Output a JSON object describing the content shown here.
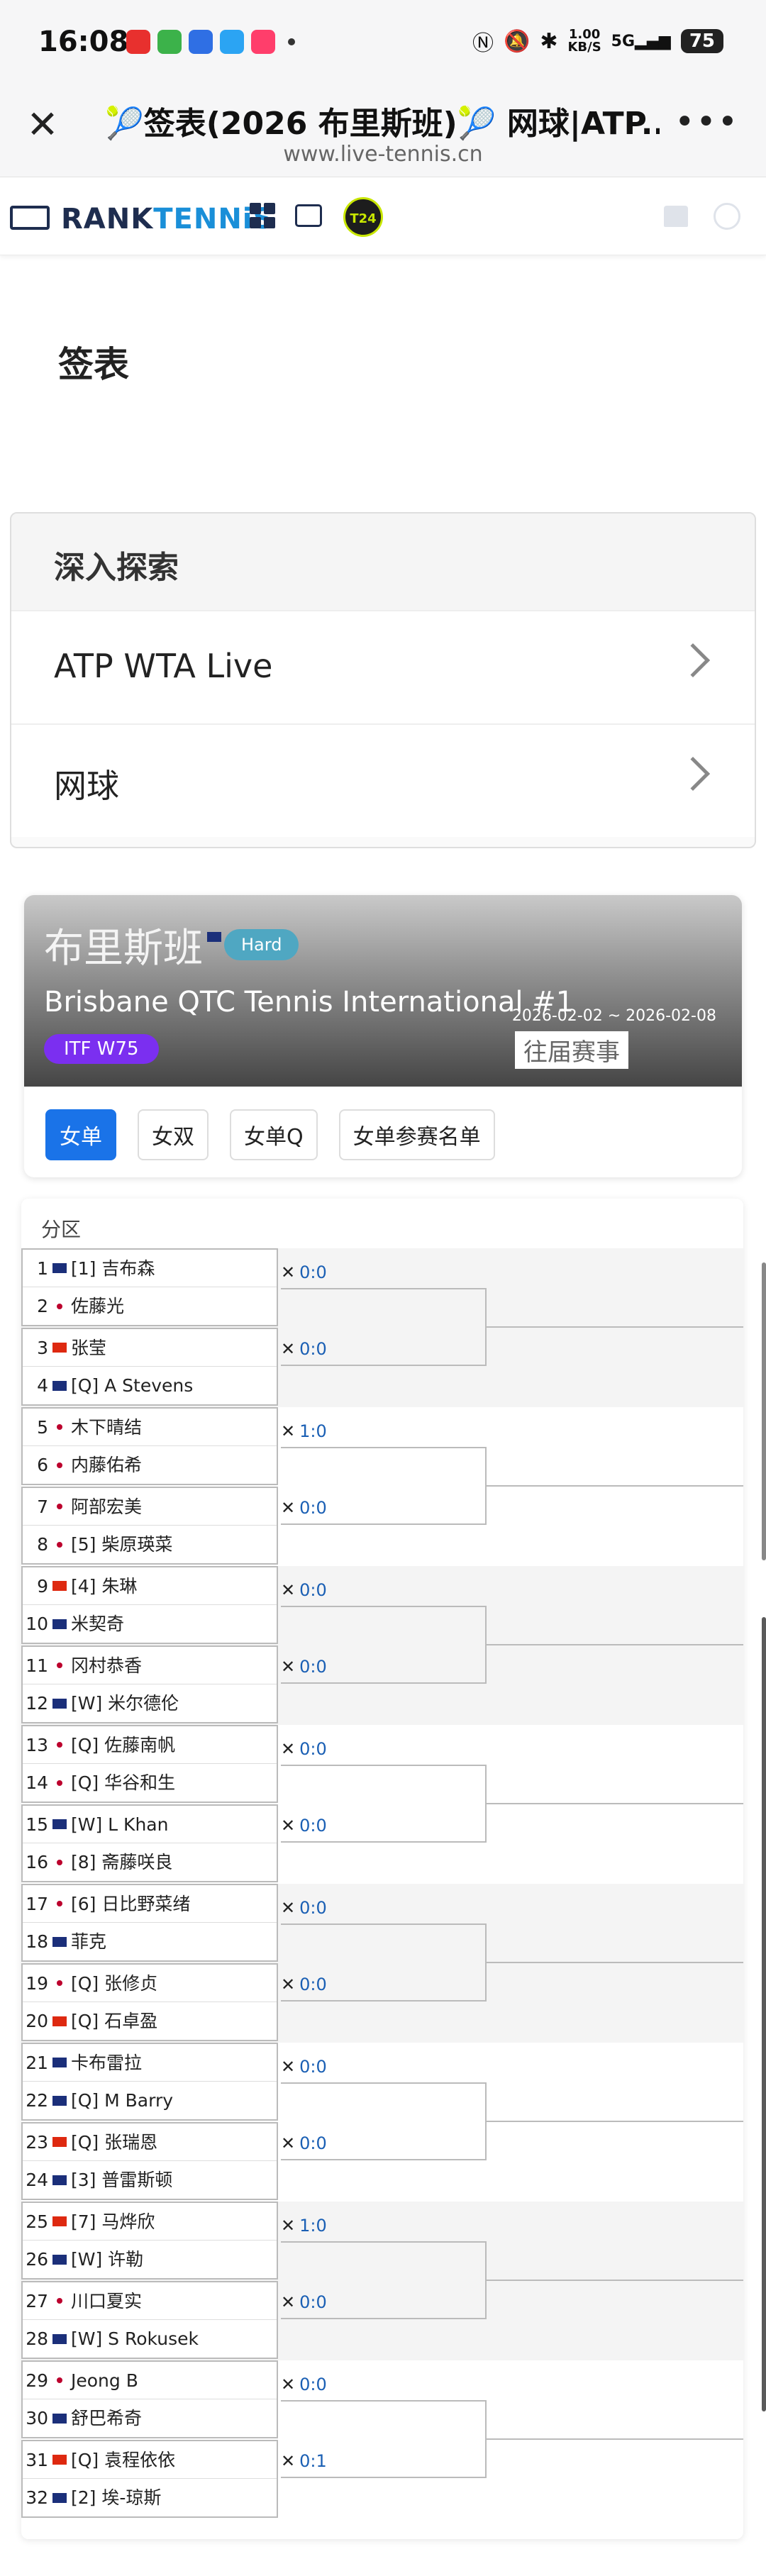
{
  "status_bar": {
    "time": "16:08",
    "speed_value": "1.00",
    "speed_unit": "KB/S",
    "network": "5G",
    "battery": "75"
  },
  "browser": {
    "title": "🎾签表(2026 布里斯班)🎾 网球|ATP...",
    "url": "www.live-tennis.cn",
    "close_icon": "close-icon",
    "more_icon": "more-dots-icon"
  },
  "site_nav": {
    "logo_text_a": "RANK",
    "logo_text_b": "TENNiS",
    "t24_label": "T24"
  },
  "section_title": "签表",
  "explore": {
    "heading": "深入探索",
    "items": [
      {
        "label": "ATP WTA Live"
      },
      {
        "label": "网球"
      }
    ]
  },
  "tournament": {
    "city": "布里斯班",
    "surface": "Hard",
    "name": "Brisbane QTC Tennis International #1",
    "dates": "2026-02-02 ~ 2026-02-08",
    "level": "ITF W75",
    "past_events": "往届赛事",
    "tabs": [
      "女单",
      "女双",
      "女单Q",
      "女单参赛名单"
    ]
  },
  "draw": {
    "heading": "分区",
    "colors": {
      "AUS": "#1b2f7a",
      "JPN": "#ffffff",
      "CHN": "#de2910",
      "KOR": "#ffffff",
      "HKG": "#de2910"
    },
    "matches": [
      {
        "p1": {
          "num": "1",
          "flag": "AUS",
          "name": "[1] 吉布森"
        },
        "p2": {
          "num": "2",
          "flag": "JPN",
          "name": "佐藤光"
        }
      },
      {
        "p1": {
          "num": "3",
          "flag": "CHN",
          "name": "张莹"
        },
        "p2": {
          "num": "4",
          "flag": "AUS",
          "name": "[Q] A Stevens"
        }
      },
      {
        "p1": {
          "num": "5",
          "flag": "JPN",
          "name": "木下晴结"
        },
        "p2": {
          "num": "6",
          "flag": "JPN",
          "name": "内藤佑希"
        }
      },
      {
        "p1": {
          "num": "7",
          "flag": "JPN",
          "name": "阿部宏美"
        },
        "p2": {
          "num": "8",
          "flag": "JPN",
          "name": "[5] 柴原瑛菜"
        }
      },
      {
        "p1": {
          "num": "9",
          "flag": "CHN",
          "name": "[4] 朱琳"
        },
        "p2": {
          "num": "10",
          "flag": "AUS",
          "name": "米契奇"
        }
      },
      {
        "p1": {
          "num": "11",
          "flag": "JPN",
          "name": "冈村恭香"
        },
        "p2": {
          "num": "12",
          "flag": "AUS",
          "name": "[W] 米尔德伦"
        }
      },
      {
        "p1": {
          "num": "13",
          "flag": "JPN",
          "name": "[Q] 佐藤南帆"
        },
        "p2": {
          "num": "14",
          "flag": "JPN",
          "name": "[Q] 华谷和生"
        }
      },
      {
        "p1": {
          "num": "15",
          "flag": "AUS",
          "name": "[W] L Khan"
        },
        "p2": {
          "num": "16",
          "flag": "JPN",
          "name": "[8] 斋藤咲良"
        }
      },
      {
        "p1": {
          "num": "17",
          "flag": "JPN",
          "name": "[6] 日比野菜绪"
        },
        "p2": {
          "num": "18",
          "flag": "AUS",
          "name": "菲克"
        }
      },
      {
        "p1": {
          "num": "19",
          "flag": "KOR",
          "name": "[Q] 张修贞"
        },
        "p2": {
          "num": "20",
          "flag": "HKG",
          "name": "[Q] 石卓盈"
        }
      },
      {
        "p1": {
          "num": "21",
          "flag": "AUS",
          "name": "卡布雷拉"
        },
        "p2": {
          "num": "22",
          "flag": "AUS",
          "name": "[Q] M Barry"
        }
      },
      {
        "p1": {
          "num": "23",
          "flag": "CHN",
          "name": "[Q] 张瑞恩"
        },
        "p2": {
          "num": "24",
          "flag": "AUS",
          "name": "[3] 普雷斯顿"
        }
      },
      {
        "p1": {
          "num": "25",
          "flag": "CHN",
          "name": "[7] 马烨欣"
        },
        "p2": {
          "num": "26",
          "flag": "AUS",
          "name": "[W] 许勒"
        }
      },
      {
        "p1": {
          "num": "27",
          "flag": "JPN",
          "name": "川口夏实"
        },
        "p2": {
          "num": "28",
          "flag": "AUS",
          "name": "[W] S Rokusek"
        }
      },
      {
        "p1": {
          "num": "29",
          "flag": "KOR",
          "name": "Jeong B"
        },
        "p2": {
          "num": "30",
          "flag": "AUS",
          "name": "舒巴希奇"
        }
      },
      {
        "p1": {
          "num": "31",
          "flag": "CHN",
          "name": "[Q] 袁程依依"
        },
        "p2": {
          "num": "32",
          "flag": "AUS",
          "name": "[2] 埃-琼斯"
        }
      }
    ],
    "scores": [
      "0:0",
      "0:0",
      "1:0",
      "0:0",
      "0:0",
      "0:0",
      "0:0",
      "0:0",
      "0:0",
      "0:0",
      "0:0",
      "0:0",
      "1:0",
      "0:0",
      "0:0",
      "0:1"
    ]
  }
}
